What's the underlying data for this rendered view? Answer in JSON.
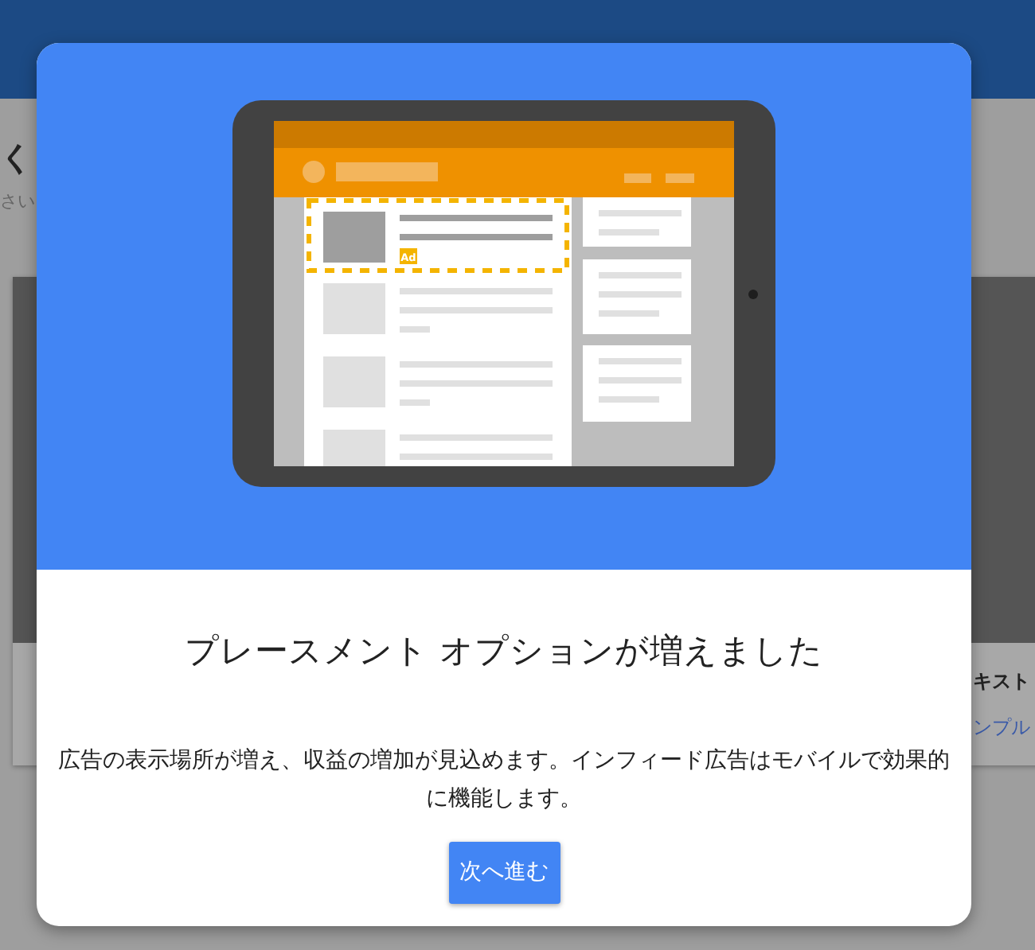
{
  "background_page": {
    "heading": "く",
    "subheading": "さい",
    "card_title": "キスト",
    "card_link": "ンプル"
  },
  "dialog": {
    "illustration": {
      "kind": "picture",
      "badge": "Ad"
    },
    "title": "プレースメント オプションが増えました",
    "body": "広告の表示場所が増え、収益の増加が見込めます。インフィード広告はモバイルで効果的に機能します。",
    "button": "次へ進む"
  }
}
